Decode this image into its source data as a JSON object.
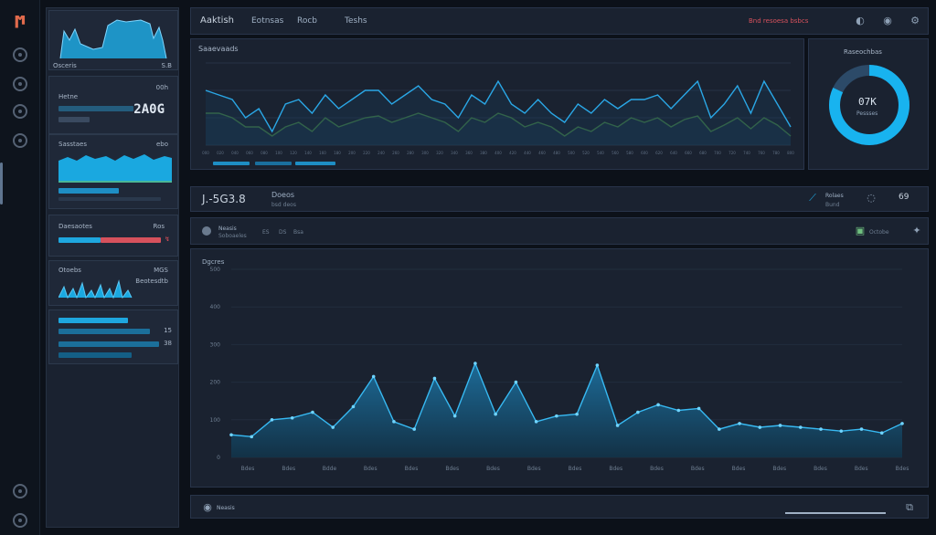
{
  "app": {
    "title": "Aaktish",
    "tabs": [
      "Eotnsas",
      "Rocb",
      "Teshs"
    ],
    "status_text": "Bnd resoesa bsbcs",
    "sub_status_text": "",
    "accent_color": "#19a7e3",
    "danger_color": "#e0505a"
  },
  "widgets": {
    "w1": {
      "left_label": "Osceris",
      "right_label": "S.B"
    },
    "w2": {
      "label": "Hetne",
      "right_label": "00h",
      "big_value": "2A0G"
    },
    "w3": {
      "label": "Sasstaes",
      "right_label": "ebo"
    },
    "w4": {
      "label": "Daesaotes",
      "right_label": "Ros"
    },
    "w5": {
      "label": "Otoebs",
      "right_label": "MGS",
      "sub_label": "Beotesdtb"
    },
    "w6": {
      "bars": [
        {
          "value": 0.72,
          "value_label": ""
        },
        {
          "value": 0.95,
          "value_label": "15"
        },
        {
          "value": 0.85,
          "value_label": "38"
        }
      ]
    }
  },
  "top_chart": {
    "title": "Saaevaads",
    "x_tick_labels": [
      "000",
      "020",
      "040",
      "060",
      "080",
      "100",
      "120",
      "140",
      "160",
      "180",
      "200",
      "220",
      "240",
      "260",
      "280",
      "300",
      "320",
      "340",
      "360",
      "380",
      "400",
      "420",
      "440",
      "460",
      "480",
      "500",
      "520",
      "540",
      "560",
      "580",
      "600",
      "620",
      "640",
      "660",
      "680",
      "700",
      "720",
      "740",
      "760",
      "780",
      "800"
    ]
  },
  "donut": {
    "title": "Raseochbas",
    "center_value": "07K",
    "center_label": "Pessses",
    "fraction": 0.82
  },
  "mid_panel": {
    "title": "J.-5G3.8",
    "subtitle": "Doeos",
    "sub_small": "bsd deos",
    "right_label": "Rolaes",
    "right_sub": "Bund",
    "right_count": "69"
  },
  "filter_bar": {
    "items": [
      "Neasis",
      "Soboaeles",
      "ES",
      "DS",
      "Bsa"
    ],
    "right_label": "Octobe"
  },
  "bottom_chart": {
    "title": "Dgcres",
    "y_tick_labels": [
      "500",
      "400",
      "300",
      "200",
      "100",
      "0"
    ],
    "x_tick_labels": [
      "Bdes",
      "Bdes",
      "Bdde",
      "Bdes",
      "Bdes",
      "Bdes",
      "Bdes",
      "Bdes",
      "Bdes",
      "Bdes",
      "Bdes",
      "Bdes",
      "Bdes",
      "Bdes",
      "Bdes",
      "Bdes",
      "Bdes"
    ]
  },
  "chart_data": {
    "type": "area",
    "x": [
      0,
      1,
      2,
      3,
      4,
      5,
      6,
      7,
      8,
      9,
      10,
      11,
      12,
      13,
      14,
      15,
      16,
      17,
      18,
      19,
      20,
      21,
      22,
      23,
      24,
      25,
      26,
      27,
      28,
      29,
      30,
      31,
      32,
      33
    ],
    "values": [
      60,
      55,
      100,
      105,
      120,
      80,
      135,
      215,
      95,
      75,
      210,
      110,
      250,
      115,
      200,
      95,
      110,
      115,
      245,
      85,
      120,
      140,
      125,
      130,
      75,
      90,
      80,
      85,
      80,
      75,
      70,
      75,
      65,
      90
    ],
    "ylim": [
      0,
      500
    ],
    "grid": true
  }
}
